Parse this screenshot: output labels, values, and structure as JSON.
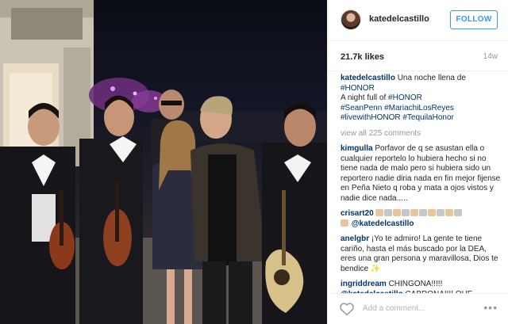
{
  "post": {
    "photo_alt": "",
    "username": "katedelcastillo",
    "follow_label": "FOLLOW",
    "likes": "21.7k likes",
    "age": "14w",
    "caption": {
      "user": "katedelcastillo",
      "text_1": "Una noche llena de",
      "tag_1": "#HONOR",
      "text_2": "A night full of",
      "tag_2": "#HONOR",
      "tags_line_3a": "#SeanPenn",
      "tags_line_3b": "#MariachiLosReyes",
      "tags_line_4a": "#livewithHONOR",
      "tags_line_4b": "#TequilaHonor"
    },
    "view_all": "view all 225 comments",
    "comments": [
      {
        "user": "kimgulla",
        "text": "Porfavor de q se asustan ella o cualquier reportelo lo hubiera hecho si no tiene nada de malo pero si hubiera sido un reportero nadie diria nada en fin mejor fijense en Peña Nieto q roba y mata a ojos vistos y nadie dice nada....."
      },
      {
        "user": "crisart20",
        "mention": "@katedelcastillo"
      },
      {
        "user": "anelgbr",
        "text": "¡Yo te admiro! La gente te tiene cariño, hasta el más buscado por la DEA, eres una gran persona y maravillosa, Dios te bendice"
      },
      {
        "user": "ingriddream",
        "text_1": "CHINGONA!!!!!",
        "mention": "@katedelcastillo",
        "text_2": "CABRONA!!!! QUE"
      }
    ],
    "add_comment_placeholder": "Add a comment...",
    "more_label": "•••"
  },
  "icons": {
    "heart": "heart-icon",
    "more": "more-options-icon",
    "avatar": "avatar"
  },
  "colors": {
    "link": "#003569",
    "follow": "#3897f0",
    "muted": "#999999"
  }
}
